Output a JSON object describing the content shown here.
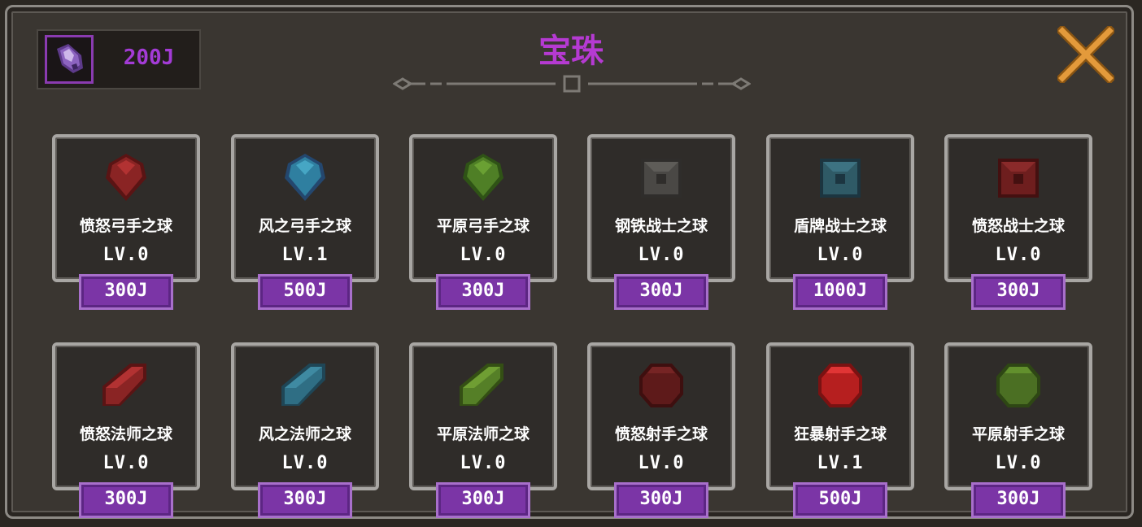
{
  "title": "宝珠",
  "currency": {
    "amount": "200J",
    "icon": "purple-crystal-icon"
  },
  "close_icon": "close-x-icon",
  "items": [
    {
      "name": "愤怒弓手之球",
      "level": "LV.0",
      "price": "300J",
      "gem": "teardrop",
      "color": "#8a2424",
      "shade": "#5a1414",
      "hi": "#b23232"
    },
    {
      "name": "风之弓手之球",
      "level": "LV.1",
      "price": "500J",
      "gem": "teardrop",
      "color": "#2f7fa0",
      "shade": "#24476e",
      "hi": "#46a6c4"
    },
    {
      "name": "平原弓手之球",
      "level": "LV.0",
      "price": "300J",
      "gem": "teardrop",
      "color": "#4f7f26",
      "shade": "#2f5316",
      "hi": "#6aa033"
    },
    {
      "name": "钢铁战士之球",
      "level": "LV.0",
      "price": "300J",
      "gem": "square",
      "color": "#4a4845",
      "shade": "#2f2d2b",
      "hi": "#5e5c58"
    },
    {
      "name": "盾牌战士之球",
      "level": "LV.0",
      "price": "1000J",
      "gem": "square",
      "color": "#2f5a66",
      "shade": "#1c3540",
      "hi": "#3d7282"
    },
    {
      "name": "愤怒战士之球",
      "level": "LV.0",
      "price": "300J",
      "gem": "square",
      "color": "#6e1e1e",
      "shade": "#441010",
      "hi": "#8a2a2a"
    },
    {
      "name": "愤怒法师之球",
      "level": "LV.0",
      "price": "300J",
      "gem": "bar",
      "color": "#8a2424",
      "shade": "#5a1414",
      "hi": "#b23232"
    },
    {
      "name": "风之法师之球",
      "level": "LV.0",
      "price": "300J",
      "gem": "bar",
      "color": "#2f6e84",
      "shade": "#1f4656",
      "hi": "#3f8aa2"
    },
    {
      "name": "平原法师之球",
      "level": "LV.0",
      "price": "300J",
      "gem": "bar",
      "color": "#557f27",
      "shade": "#344f14",
      "hi": "#6f9e33"
    },
    {
      "name": "愤怒射手之球",
      "level": "LV.0",
      "price": "300J",
      "gem": "octagon",
      "color": "#5e1a1a",
      "shade": "#3e0f0f",
      "hi": "#762424"
    },
    {
      "name": "狂暴射手之球",
      "level": "LV.1",
      "price": "500J",
      "gem": "octagon",
      "color": "#b61f1f",
      "shade": "#7a1212",
      "hi": "#e03535"
    },
    {
      "name": "平原射手之球",
      "level": "LV.0",
      "price": "300J",
      "gem": "octagon",
      "color": "#4b6f23",
      "shade": "#2e4714",
      "hi": "#62902d"
    }
  ]
}
